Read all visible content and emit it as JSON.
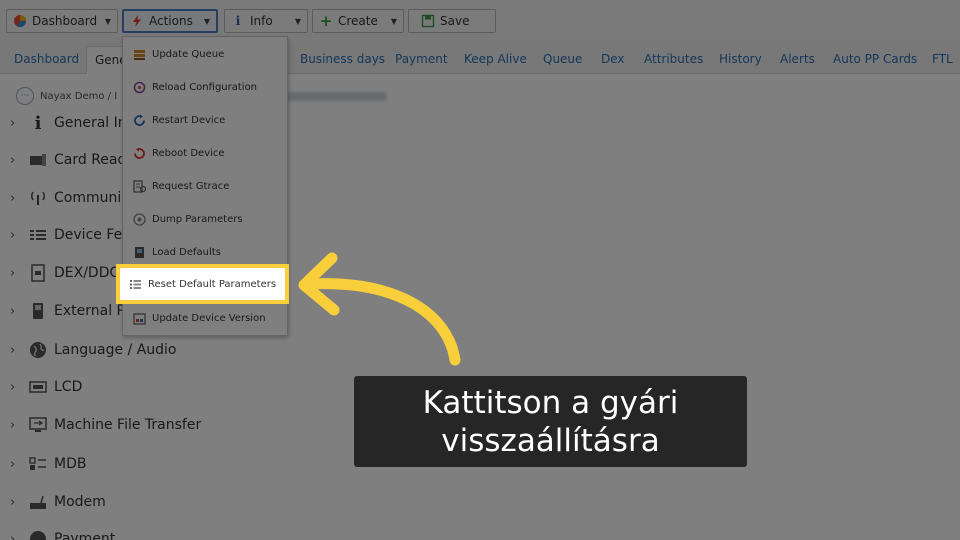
{
  "toolbar": {
    "dashboard_label": "Dashboard",
    "actions_label": "Actions",
    "info_label": "Info",
    "create_label": "Create",
    "save_label": "Save"
  },
  "tabs": [
    {
      "label": "Dashboard"
    },
    {
      "label": "Gene"
    },
    {
      "label": "Business days"
    },
    {
      "label": "Payment"
    },
    {
      "label": "Keep Alive"
    },
    {
      "label": "Queue"
    },
    {
      "label": "Dex"
    },
    {
      "label": "Attributes"
    },
    {
      "label": "History"
    },
    {
      "label": "Alerts"
    },
    {
      "label": "Auto PP Cards"
    },
    {
      "label": "FTL"
    }
  ],
  "breadcrumb": {
    "text": "Nayax Demo / I"
  },
  "tree": [
    {
      "label": "General Inf",
      "icon": "info-icon"
    },
    {
      "label": "Card Reade",
      "icon": "card-reader-icon"
    },
    {
      "label": "Communic",
      "icon": "antenna-icon"
    },
    {
      "label": "Device Fea",
      "icon": "device-features-icon"
    },
    {
      "label": "DEX/DDC",
      "icon": "dex-icon"
    },
    {
      "label": "External Re",
      "icon": "external-reader-icon"
    },
    {
      "label": "Language / Audio",
      "icon": "globe-icon"
    },
    {
      "label": "LCD",
      "icon": "lcd-icon"
    },
    {
      "label": "Machine File Transfer",
      "icon": "file-transfer-icon"
    },
    {
      "label": "MDB",
      "icon": "mdb-icon"
    },
    {
      "label": "Modem",
      "icon": "modem-icon"
    },
    {
      "label": "Payment",
      "icon": "payment-icon"
    }
  ],
  "actions_menu": [
    {
      "label": "Update Queue",
      "icon": "queue-icon"
    },
    {
      "label": "Reload Configuration",
      "icon": "reload-icon"
    },
    {
      "label": "Restart Device",
      "icon": "restart-icon"
    },
    {
      "label": "Reboot Device",
      "icon": "reboot-icon"
    },
    {
      "label": "Request Gtrace",
      "icon": "trace-icon"
    },
    {
      "label": "Dump Parameters",
      "icon": "dump-icon"
    },
    {
      "label": "Load Defaults",
      "icon": "load-defaults-icon"
    },
    {
      "label": "Reset Default Parameters",
      "icon": "reset-params-icon"
    },
    {
      "label": "Update Device Version",
      "icon": "update-version-icon"
    }
  ],
  "callout": {
    "line1": "Kattitson a gyári",
    "line2": "visszaállításra"
  },
  "colors": {
    "highlight": "#f8cf3a",
    "callout_bg": "#262626",
    "link": "#2b6fb5"
  }
}
